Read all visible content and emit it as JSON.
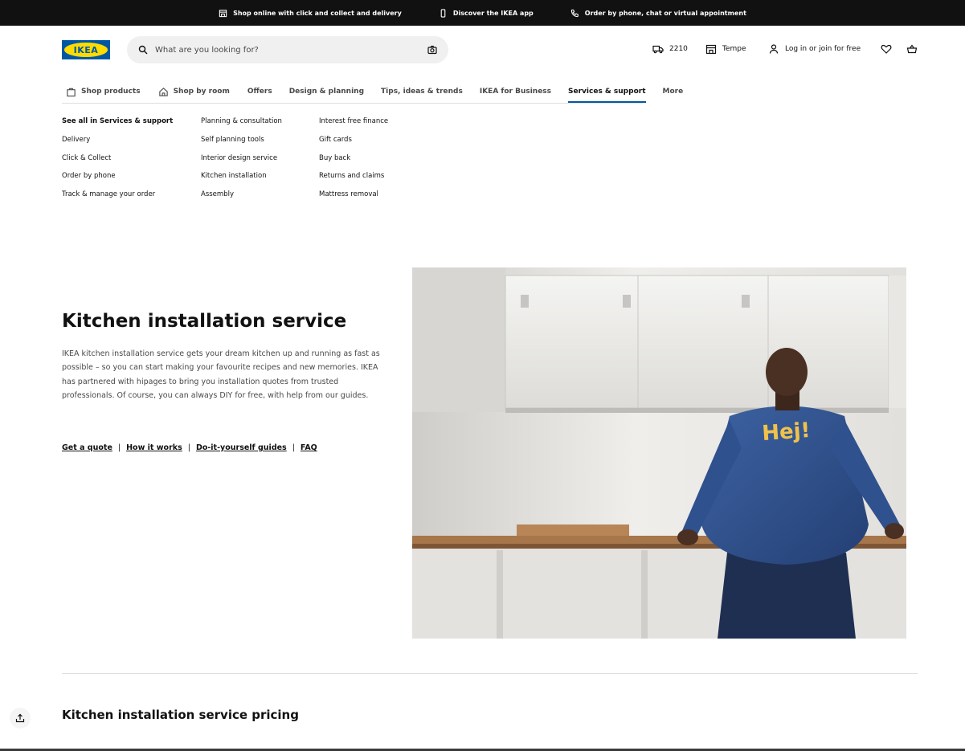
{
  "topbar": {
    "promos": [
      {
        "icon": "store-icon",
        "label": "Shop online with click and collect and delivery"
      },
      {
        "icon": "phone-icon",
        "label": "Discover the IKEA app"
      },
      {
        "icon": "call-icon",
        "label": "Order by phone, chat or virtual appointment"
      }
    ]
  },
  "header": {
    "logo_text": "IKEA",
    "search": {
      "placeholder": "What are you looking for?"
    },
    "delivery_postcode": "2210",
    "store_name": "Tempe",
    "login_label": "Log in or join for free"
  },
  "nav": {
    "items": [
      {
        "label": "Shop products",
        "icon": "bag-icon"
      },
      {
        "label": "Shop by room",
        "icon": "house-icon"
      },
      {
        "label": "Offers"
      },
      {
        "label": "Design & planning"
      },
      {
        "label": "Tips, ideas & trends"
      },
      {
        "label": "IKEA for Business"
      },
      {
        "label": "Services & support",
        "active": true
      },
      {
        "label": "More"
      }
    ]
  },
  "menu": {
    "col1": [
      "See all in Services & support",
      "Delivery",
      "Click & Collect",
      "Order by phone",
      "Track & manage your order"
    ],
    "col2": [
      "Planning & consultation",
      "Self planning tools",
      "Interior design service",
      "Kitchen installation",
      "Assembly"
    ],
    "col3": [
      "Interest free finance",
      "Gift cards",
      "Buy back",
      "Returns and claims",
      "Mattress removal"
    ]
  },
  "hero": {
    "title": "Kitchen installation service",
    "body": "IKEA kitchen installation service gets your dream kitchen up and running as fast as possible – so you can start making your favourite recipes and new memories. IKEA has partnered with hipages to bring you installation quotes from trusted professionals. Of course, you can always DIY for free, with help from our guides.",
    "links": [
      "Get a quote",
      "How it works",
      "Do-it-yourself guides",
      "FAQ"
    ],
    "separator": "|",
    "jacket_text": "Hej!"
  },
  "pricing": {
    "title": "Kitchen installation service pricing"
  },
  "colors": {
    "brand_blue": "#0058a3",
    "brand_yellow": "#ffdb00",
    "text": "#111111",
    "topbar": "#111111"
  }
}
